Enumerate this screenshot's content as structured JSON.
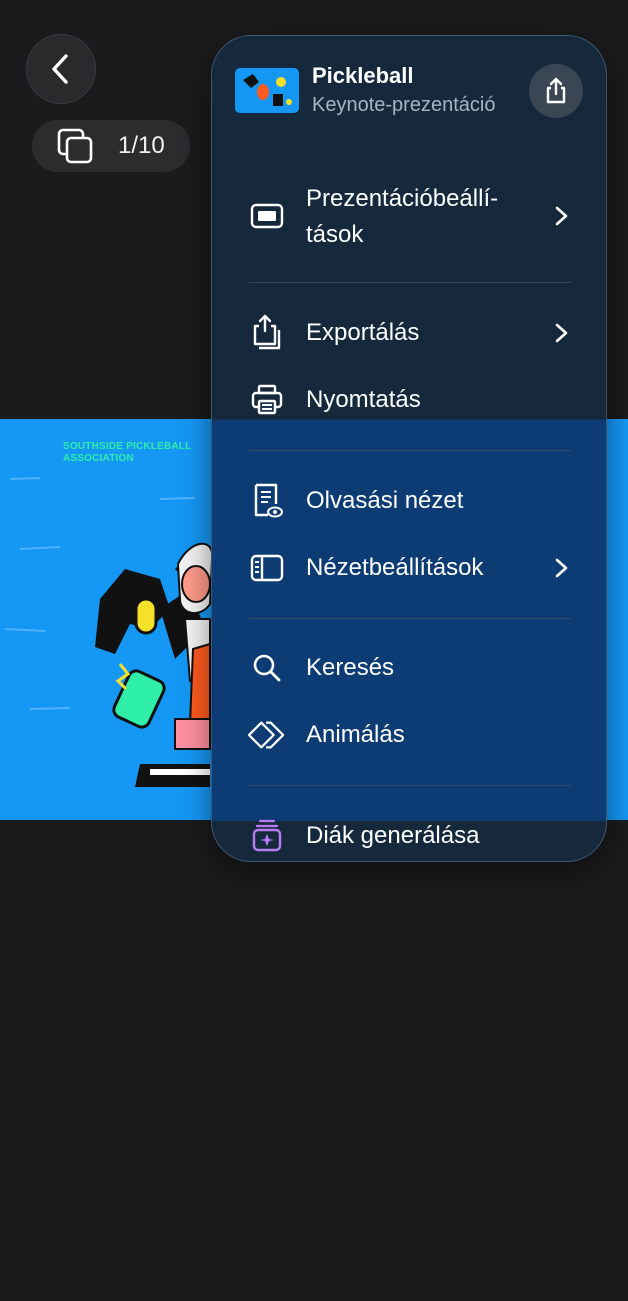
{
  "nav": {
    "slide_counter": "1/10"
  },
  "slide": {
    "association": "SOUTHSIDE PICKLEBALL ASSOCIATION"
  },
  "menu": {
    "doc_title": "Pickleball",
    "doc_subtitle": "Keynote-prezentáció",
    "items": [
      {
        "label_line1": "Prezentációbeállí-",
        "label_line2": "tások"
      },
      {
        "label": "Exportálás"
      },
      {
        "label": "Nyomtatás"
      },
      {
        "label": "Olvasási nézet"
      },
      {
        "label": "Nézetbeállítások"
      },
      {
        "label": "Keresés"
      },
      {
        "label": "Animálás"
      },
      {
        "label": "Diák generálása"
      }
    ]
  },
  "colors": {
    "slide_bg": "#1597f5",
    "accent_green": "#2ef0a8",
    "generate_icon": "#b57cf6"
  }
}
